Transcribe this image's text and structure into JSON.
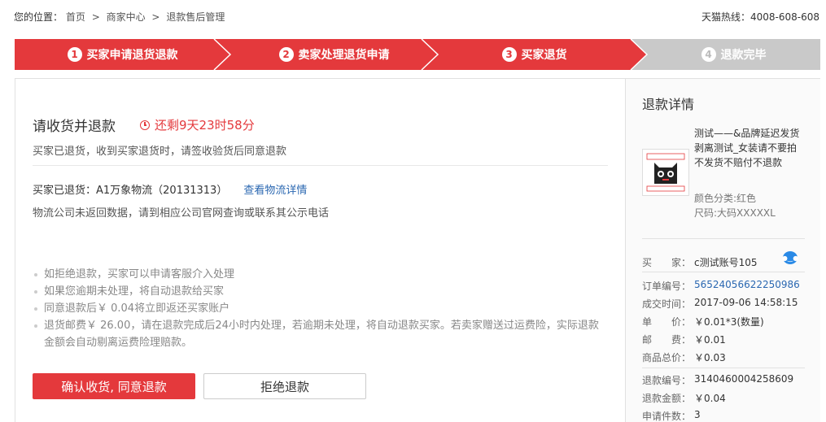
{
  "breadcrumb": {
    "prefix": "您的位置：",
    "items": [
      "首页",
      "商家中心",
      "退款售后管理"
    ],
    "separator": ">"
  },
  "hotline": "天猫热线：4008-608-608",
  "steps": [
    {
      "num": "1",
      "label": "买家申请退货退款",
      "state": "active"
    },
    {
      "num": "2",
      "label": "卖家处理退货申请",
      "state": "active"
    },
    {
      "num": "3",
      "label": "买家退货",
      "state": "active"
    },
    {
      "num": "4",
      "label": "退款完毕",
      "state": "inactive"
    }
  ],
  "main": {
    "title": "请收货并退款",
    "countdown": "还剩9天23时58分",
    "subtitle": "买家已退货，收到买家退货时，请签收验货后同意退款",
    "logistics_text": "买家已退货：A1万象物流（20131313）",
    "logistics_link": "查看物流详情",
    "logistics_note": "物流公司未返回数据，请到相应公司官网查询或联系其公示电话",
    "notes": [
      "如拒绝退款，买家可以申请客服介入处理",
      "如果您逾期未处理，将自动退款给买家",
      "同意退款后￥ 0.04将立即返还买家账户",
      "退货邮费￥ 26.00，请在退款完成后24小时内处理，若逾期未处理，将自动退款买家。若卖家赠送过运费险，实际退款金额会自动剔离运费险理赔款。"
    ],
    "confirm_button": "确认收货, 同意退款",
    "reject_button": "拒绝退款"
  },
  "detail": {
    "title": "退款详情",
    "product_name": "测试——&品牌延迟发货剥离测试_女装请不要拍不发货不赔付不退款",
    "color": "颜色分类:红色",
    "size": "尺码:大码XXXXXL",
    "buyer_label": "买　　家：",
    "buyer_value": "c测试账号105",
    "order_no_label": "订单编号：",
    "order_no_value": "56524056622250986",
    "deal_time_label": "成交时间：",
    "deal_time_value": "2017-09-06 14:58:15",
    "unit_price_label": "单　　价：",
    "unit_price_value": "￥0.01*3(数量)",
    "postage_label": "邮　　费：",
    "postage_value": "￥0.01",
    "total_label": "商品总价：",
    "total_value": "￥0.03",
    "refund_no_label": "退款编号：",
    "refund_no_value": "3140460004258609",
    "refund_amount_label": "退款金额：",
    "refund_amount_value": "￥0.04",
    "apply_count_label": "申请件数：",
    "apply_count_value": "3"
  },
  "colors": {
    "accent": "#e4393c",
    "inactive_step": "#c9c9c9",
    "link": "#2a67b1"
  }
}
